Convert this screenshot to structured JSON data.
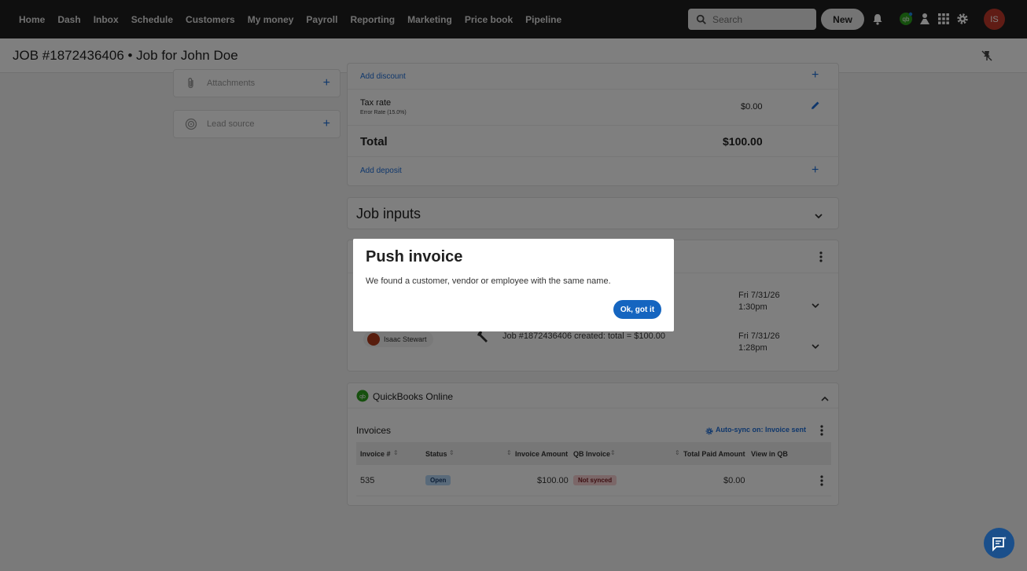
{
  "nav": {
    "links": [
      "Home",
      "Dash",
      "Inbox",
      "Schedule",
      "Customers",
      "My money",
      "Payroll",
      "Reporting",
      "Marketing",
      "Price book",
      "Pipeline"
    ],
    "search_placeholder": "Search",
    "new_label": "New",
    "avatar_initials": "IS"
  },
  "title": "JOB #1872436406 • Job for John Doe",
  "sidebar": {
    "attachments_label": "Attachments",
    "lead_source_label": "Lead source"
  },
  "invoice_totals": {
    "add_discount": "Add discount",
    "tax_rate_label": "Tax rate",
    "tax_rate_sub": "Error Rate (15.0%)",
    "tax_value": "$0.00",
    "total_label": "Total",
    "total_value": "$100.00",
    "add_deposit": "Add deposit"
  },
  "job_inputs": {
    "title": "Job inputs"
  },
  "activity": {
    "row1_date": "Fri 7/31/26",
    "row1_time": "1:30pm",
    "row2_user": "Isaac Stewart",
    "row2_text": "Job #1872436406 created: total = $100.00",
    "row2_date": "Fri 7/31/26",
    "row2_time": "1:28pm"
  },
  "quickbooks": {
    "title": "QuickBooks Online",
    "invoices_label": "Invoices",
    "autosync_label": "Auto-sync on: Invoice sent",
    "columns": [
      "Invoice #",
      "Status",
      "Invoice Amount",
      "QB Invoice",
      "Total Paid Amount",
      "View in QB"
    ],
    "rows": [
      {
        "invoice_no": "535",
        "status": "Open",
        "amount": "$100.00",
        "qb_invoice": "Not synced",
        "paid": "$0.00"
      }
    ]
  },
  "modal": {
    "title": "Push invoice",
    "message": "We found a customer, vendor or employee with the same name.",
    "ok_label": "Ok, got it"
  },
  "colors": {
    "accent": "#1e6fd9",
    "nav_bg": "#1f1f1f",
    "avatar": "#c0392b",
    "qb_green": "#2ca01c"
  }
}
